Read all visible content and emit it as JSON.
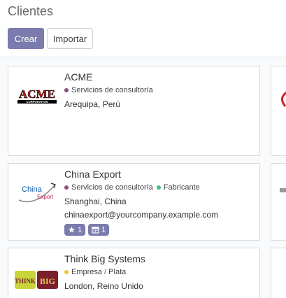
{
  "header": {
    "title": "Clientes",
    "create_label": "Crear",
    "import_label": "Importar"
  },
  "colors": {
    "accent": "#7c7bad",
    "tag_consultoria": "#8b4f7a",
    "tag_fabricante": "#3fbf7f",
    "tag_empresa": "#f1c232"
  },
  "cards": [
    {
      "name": "ACME",
      "logo_text": "ACME",
      "logo_subtext": "CORPORATION",
      "tags": [
        {
          "label": "Servicios de consultoría"
        }
      ],
      "location": "Arequipa, Perú"
    },
    {
      "name": "China Export",
      "logo_text": "China",
      "logo_subtext": "Export",
      "tags": [
        {
          "label": "Servicios de consultoría"
        },
        {
          "label": "Fabricante"
        }
      ],
      "location": "Shanghai, China",
      "email": "chinaexport@yourcompany.example.com",
      "badges": [
        {
          "icon": "star-icon",
          "count": "1"
        },
        {
          "icon": "calendar-icon",
          "count": "1"
        }
      ]
    },
    {
      "name": "Think Big Systems",
      "logo_text_1": "THINK",
      "logo_text_2": "BIG",
      "tags": [
        {
          "label": "Empresa / Plata"
        }
      ],
      "location": "London, Reino Unido"
    }
  ]
}
